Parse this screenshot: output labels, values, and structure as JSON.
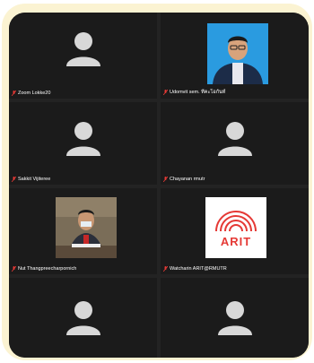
{
  "participants": [
    {
      "name": "Zoom Lokke20",
      "video": false
    },
    {
      "name": "Udomvit sem. ทีคะโอกันท์",
      "video": true
    },
    {
      "name": "Sakkit Vijiteree",
      "video": false
    },
    {
      "name": "Chayanan rmutr",
      "video": false
    },
    {
      "name": "Nut Thangpreecharpornich",
      "video": true
    },
    {
      "name": "Watcharin ARIT@RMUTR",
      "video": true
    },
    {
      "name": "",
      "video": false
    },
    {
      "name": "",
      "video": false
    }
  ],
  "arit_logo": {
    "text": "ARIT",
    "color": "#e53935"
  },
  "colors": {
    "frame": "#fbf3d2",
    "panel": "#232323",
    "tile": "#1b1b1b",
    "avatar": "#d8d8d8",
    "muted": "#e53935"
  }
}
